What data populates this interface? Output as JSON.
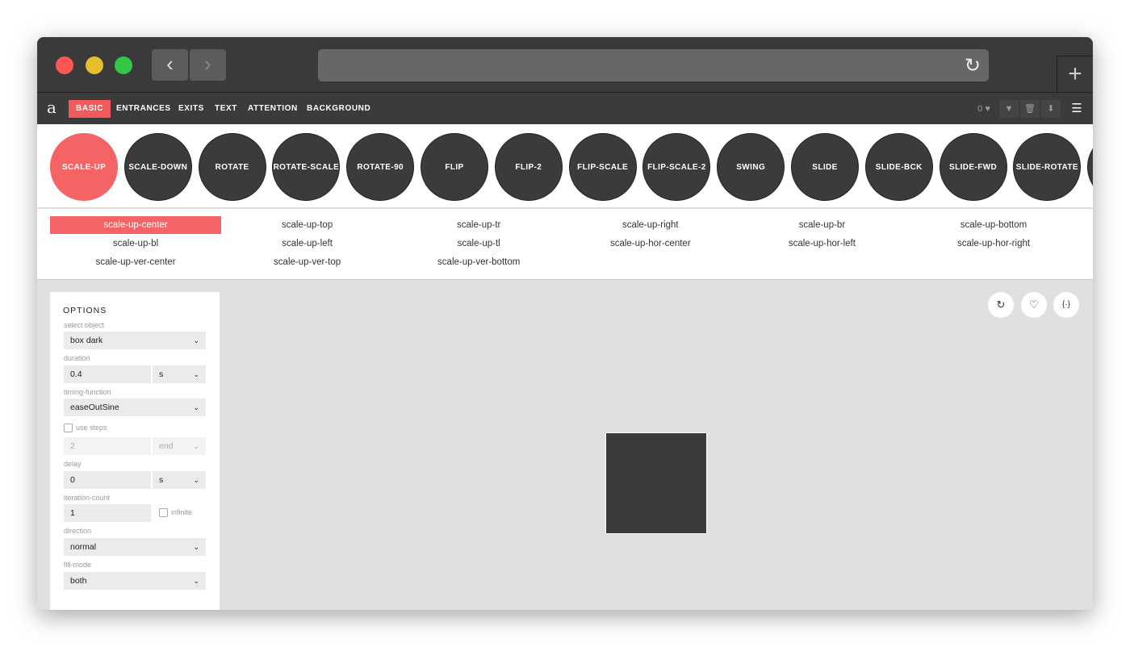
{
  "browser": {
    "back": "‹",
    "forward": "›",
    "reload_icon": "reload-icon",
    "new_tab": "+"
  },
  "nav": {
    "logo": "a",
    "tabs": [
      "BASIC",
      "ENTRANCES",
      "EXITS",
      "TEXT",
      "ATTENTION",
      "BACKGROUND"
    ],
    "active_tab": "BASIC",
    "favorites_count": "0",
    "heart": "♥",
    "filter": "▼",
    "trash": "🗑",
    "download": "⬇",
    "menu": "☰"
  },
  "animations": [
    "SCALE-UP",
    "SCALE-DOWN",
    "ROTATE",
    "ROTATE-SCALE",
    "ROTATE-90",
    "FLIP",
    "FLIP-2",
    "FLIP-SCALE",
    "FLIP-SCALE-2",
    "SWING",
    "SLIDE",
    "SLIDE-BCK",
    "SLIDE-FWD",
    "SLIDE-ROTATE"
  ],
  "variants": [
    "scale-up-center",
    "scale-up-top",
    "scale-up-tr",
    "scale-up-right",
    "scale-up-br",
    "scale-up-bottom",
    "scale-up-bl",
    "scale-up-left",
    "scale-up-tl",
    "scale-up-hor-center",
    "scale-up-hor-left",
    "scale-up-hor-right",
    "scale-up-ver-center",
    "scale-up-ver-top",
    "scale-up-ver-bottom"
  ],
  "options": {
    "title": "OPTIONS",
    "select_object_label": "select object",
    "select_object": "box dark",
    "duration_label": "duration",
    "duration": "0.4",
    "duration_unit": "s",
    "timing_label": "timing-function",
    "timing": "easeOutSine",
    "use_steps_label": "use steps",
    "steps": "2",
    "steps_pos": "end",
    "delay_label": "delay",
    "delay": "0",
    "delay_unit": "s",
    "iteration_label": "iteration-count",
    "iteration": "1",
    "infinite_label": "infinite",
    "direction_label": "direction",
    "direction": "normal",
    "fill_label": "fill-mode",
    "fill": "both",
    "chevron": "⌄"
  },
  "actions": {
    "replay": "↻",
    "favorite": "♡",
    "code": "{·}"
  },
  "colors": {
    "accent": "#f56464",
    "dark": "#3b3b3b"
  }
}
